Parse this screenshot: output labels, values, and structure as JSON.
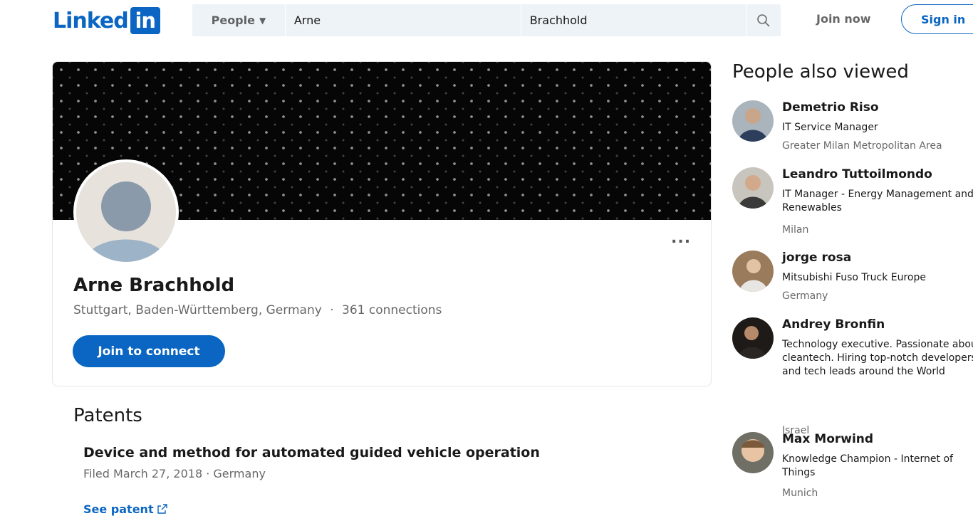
{
  "header": {
    "logo_text": "Linked",
    "logo_box": "in",
    "search_category": "People",
    "first_name_value": "Arne",
    "last_name_value": "Brachhold",
    "join_now": "Join now",
    "sign_in": "Sign in",
    "brand_color": "#0a66c2"
  },
  "profile": {
    "name": "Arne Brachhold",
    "location": "Stuttgart, Baden-Württemberg, Germany",
    "separator": "·",
    "connections": "361 connections",
    "join_button": "Join to connect",
    "more_menu": "..."
  },
  "patents": {
    "heading": "Patents",
    "items": [
      {
        "title": "Device and method for automated guided vehicle operation",
        "meta": "Filed March 27, 2018 · Germany",
        "link": "See patent"
      }
    ]
  },
  "people_also_viewed": {
    "heading": "People also viewed",
    "people": [
      {
        "name": "Demetrio Riso",
        "title": "IT Service Manager",
        "location": "Greater Milan Metropolitan Area"
      },
      {
        "name": "Leandro Tuttoilmondo",
        "title": "IT Manager - Energy Management and Renewables",
        "location": "Milan"
      },
      {
        "name": "jorge rosa",
        "title": "Mitsubishi Fuso Truck Europe",
        "location": "Germany"
      },
      {
        "name": "Andrey Bronfin",
        "title": "Technology executive. Passionate about cleantech. Hiring top-notch developers and tech leads around the World",
        "location": "Israel"
      },
      {
        "name": "Max Morwind",
        "title": "Knowledge Champion - Internet of Things",
        "location": "Munich"
      }
    ]
  }
}
